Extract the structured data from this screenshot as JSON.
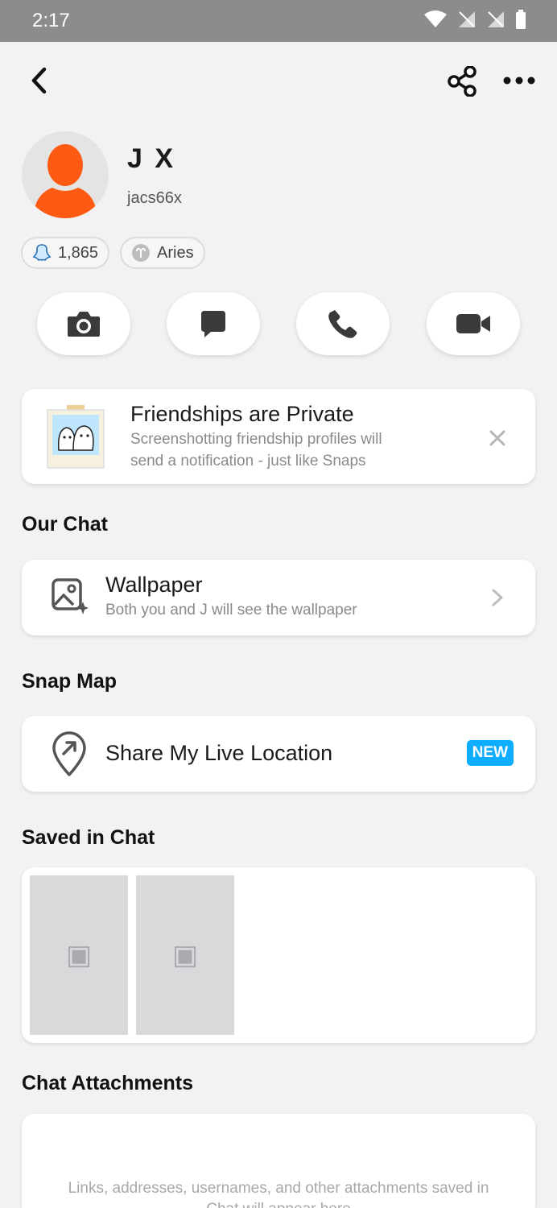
{
  "status_bar": {
    "time": "2:17"
  },
  "profile": {
    "display_name": "J X",
    "username": "jacs66x",
    "snap_score": "1,865",
    "zodiac": "Aries"
  },
  "banner": {
    "title": "Friendships are Private",
    "line1": "Screenshotting friendship profiles will",
    "line2": "send a notification - just like Snaps"
  },
  "our_chat": {
    "title": "Our Chat",
    "wallpaper_label": "Wallpaper",
    "wallpaper_sub": "Both you and J will see the wallpaper"
  },
  "snap_map": {
    "title": "Snap Map",
    "share_label": "Share My Live Location",
    "badge": "NEW"
  },
  "saved": {
    "title": "Saved in Chat",
    "items": [
      "saved-item-1",
      "saved-item-2"
    ]
  },
  "attachments": {
    "title": "Chat Attachments",
    "empty_line1": "Links, addresses, usernames, and other attachments saved in",
    "empty_line2": "Chat will appear here"
  },
  "colors": {
    "accent_blue": "#0fadff",
    "avatar_orange": "#ff5a14"
  }
}
